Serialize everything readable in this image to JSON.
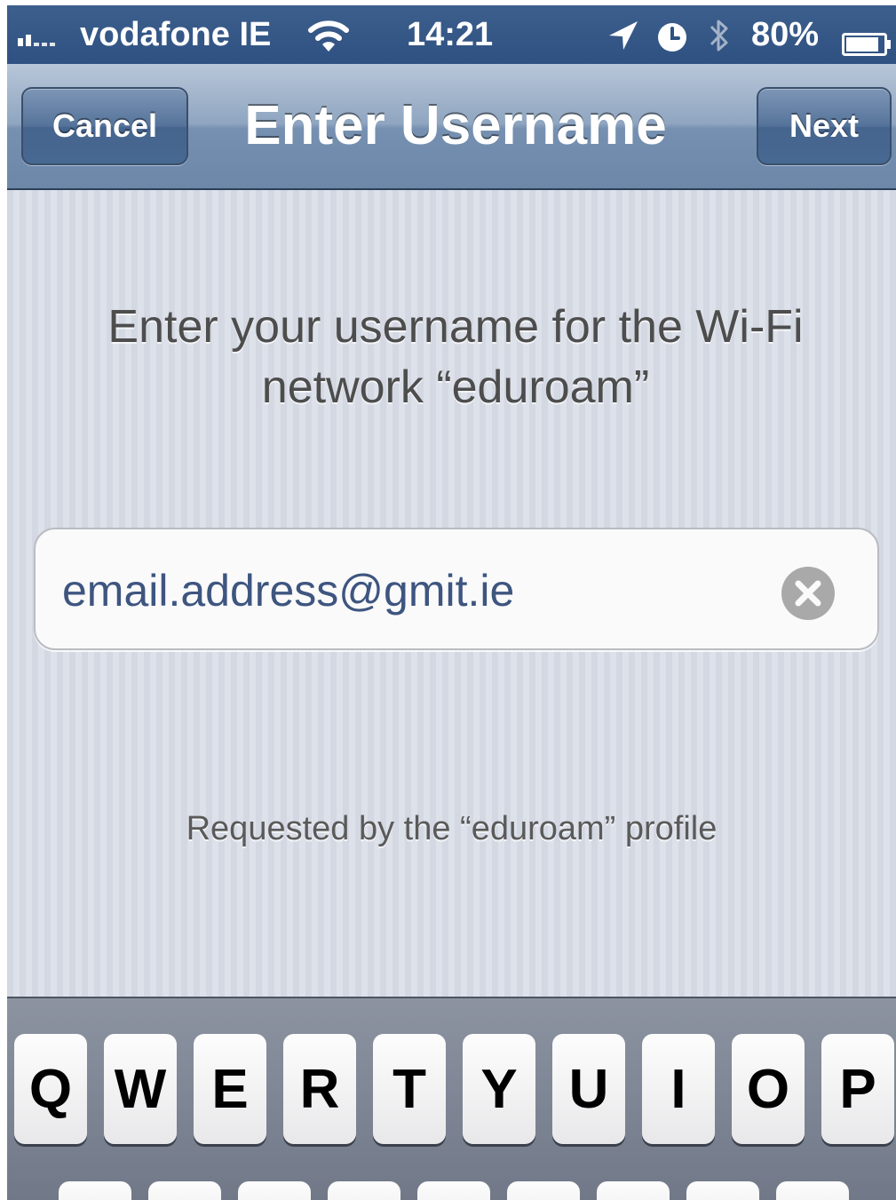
{
  "status_bar": {
    "carrier": "vodafone IE",
    "time": "14:21",
    "battery": "80%"
  },
  "nav": {
    "cancel_label": "Cancel",
    "title": "Enter Username",
    "next_label": "Next"
  },
  "content": {
    "prompt_line1": "Enter your username for the Wi-Fi",
    "prompt_line2": "network “eduroam”",
    "username_value": "email.address@gmit.ie",
    "requested_by": "Requested by the “eduroam” profile"
  },
  "keyboard": {
    "row1": [
      "Q",
      "W",
      "E",
      "R",
      "T",
      "Y",
      "U",
      "I",
      "O",
      "P"
    ]
  },
  "icons": {
    "wifi": "wifi-icon",
    "location": "location-arrow-icon",
    "clock": "clock-icon",
    "bluetooth": "bluetooth-icon",
    "battery": "battery-icon",
    "clear": "clear-circle-x-icon"
  },
  "colors": {
    "nav_bar": "#7690b1",
    "status_bar": "#2f5182",
    "input_text": "#3e5580"
  }
}
